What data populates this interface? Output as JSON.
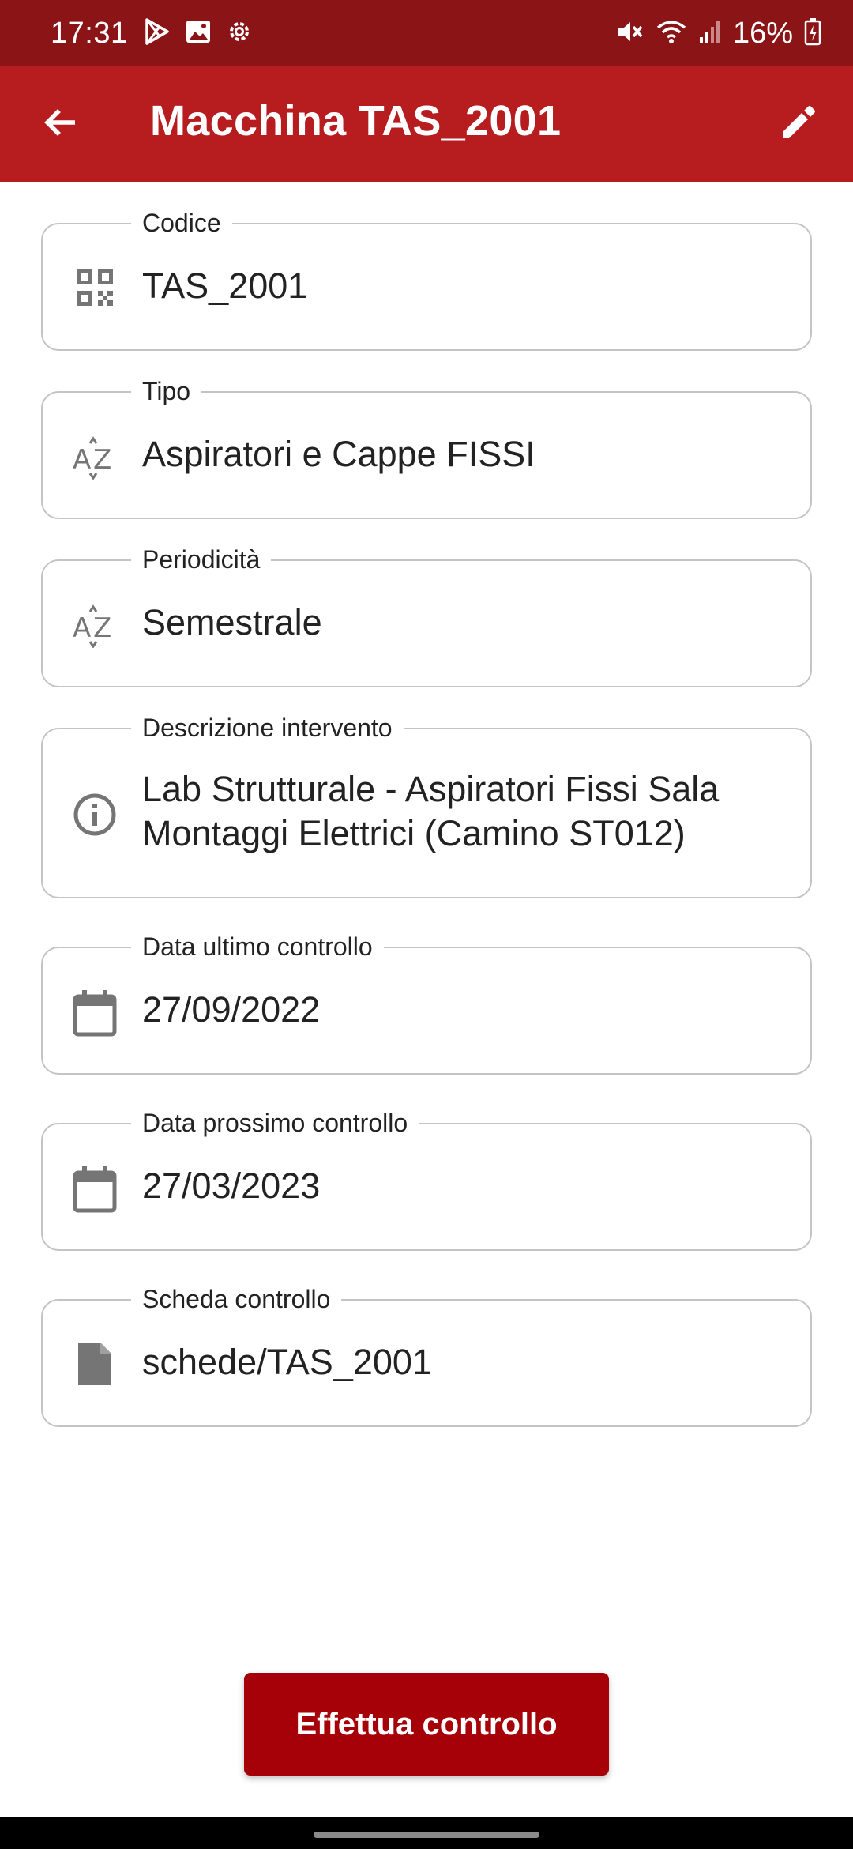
{
  "status_bar": {
    "time": "17:31",
    "left_icons": [
      "play-store-icon",
      "gallery-icon",
      "settings-icon"
    ],
    "right_icons": [
      "mute-icon",
      "wifi-icon",
      "signal-icon",
      "battery-charging-icon"
    ],
    "battery": "16%"
  },
  "app_bar": {
    "title": "Macchina TAS_2001",
    "back_icon": "arrow-back-icon",
    "edit_icon": "edit-pencil-icon",
    "color": "#b71c1f"
  },
  "fields": [
    {
      "label": "Codice",
      "value": "TAS_2001",
      "icon": "qr-code-icon"
    },
    {
      "label": "Tipo",
      "value": "Aspiratori e Cappe FISSI",
      "icon": "sort-az-icon"
    },
    {
      "label": "Periodicità",
      "value": "Semestrale",
      "icon": "sort-az-icon"
    },
    {
      "label": "Descrizione intervento",
      "value_line1": "Lab Strutturale - Aspiratori Fissi Sala",
      "value_line2": "Montaggi Elettrici (Camino ST012)",
      "icon": "info-icon"
    },
    {
      "label": "Data ultimo controllo",
      "value": "27/09/2022",
      "icon": "calendar-icon"
    },
    {
      "label": "Data prossimo controllo",
      "value": "27/03/2023",
      "icon": "calendar-icon"
    },
    {
      "label": "Scheda controllo",
      "value": "schede/TAS_2001",
      "icon": "file-icon"
    }
  ],
  "action": {
    "label": "Effettua controllo",
    "color": "#a60008"
  },
  "colors": {
    "status_bar": "#8b1416",
    "icon_gray": "#757575"
  }
}
